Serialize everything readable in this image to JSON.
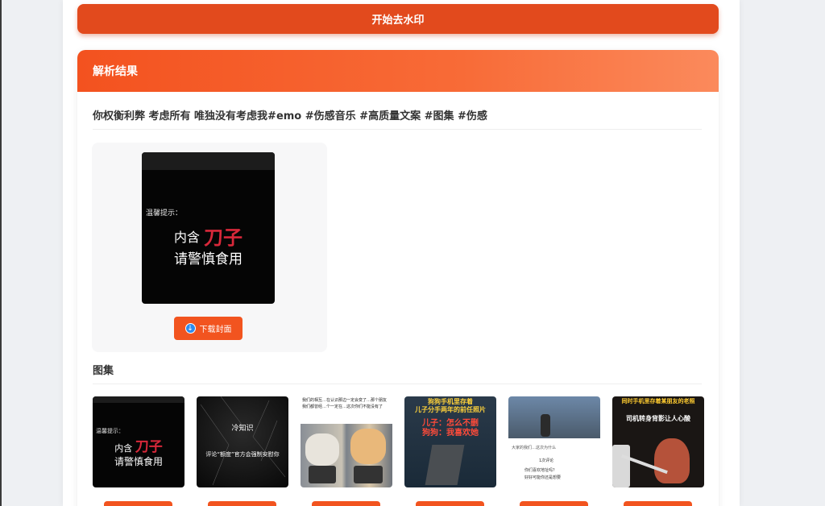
{
  "toolbar": {
    "start_label": "开始去水印"
  },
  "result": {
    "header": "解析结果",
    "description": "你权衡利弊 考虑所有 唯独没有考虑我#emo #伤感音乐 #高质量文案 #图集 #伤感",
    "cover": {
      "hint": "温馨提示：",
      "line1_prefix": "内含",
      "line1_highlight": "刀子",
      "line2": "请警慎食用",
      "download_label": "下载封面"
    },
    "gallery": {
      "title": "图集",
      "items": [
        {
          "hint": "温馨提示：",
          "line1_prefix": "内含",
          "line1_highlight": "刀子",
          "line2": "请警慎食用"
        },
        {
          "title": "冷知识",
          "caption": "评论“额度”官方会强制安慰你"
        },
        {
          "caption_top": "我们的相互…在认识那边一定会变了…那个朋友 我们都曾经…个一定在…这次你们不能没有了"
        },
        {
          "top": "狗狗手机里存着",
          "top2": "儿子分手两年的前任照片",
          "mid": "儿子：怎么不删",
          "bottom": "狗狗：我喜欢她"
        },
        {
          "caption_top": "大家的我们…这次为什么",
          "caption": "1次评论",
          "line": "你们喜欢地址吗？",
          "line2": "好好可能你还是想要"
        },
        {
          "top": "同时手机里存着某朋友的老照",
          "top2": "司机转身背影让人心酸"
        }
      ]
    }
  }
}
